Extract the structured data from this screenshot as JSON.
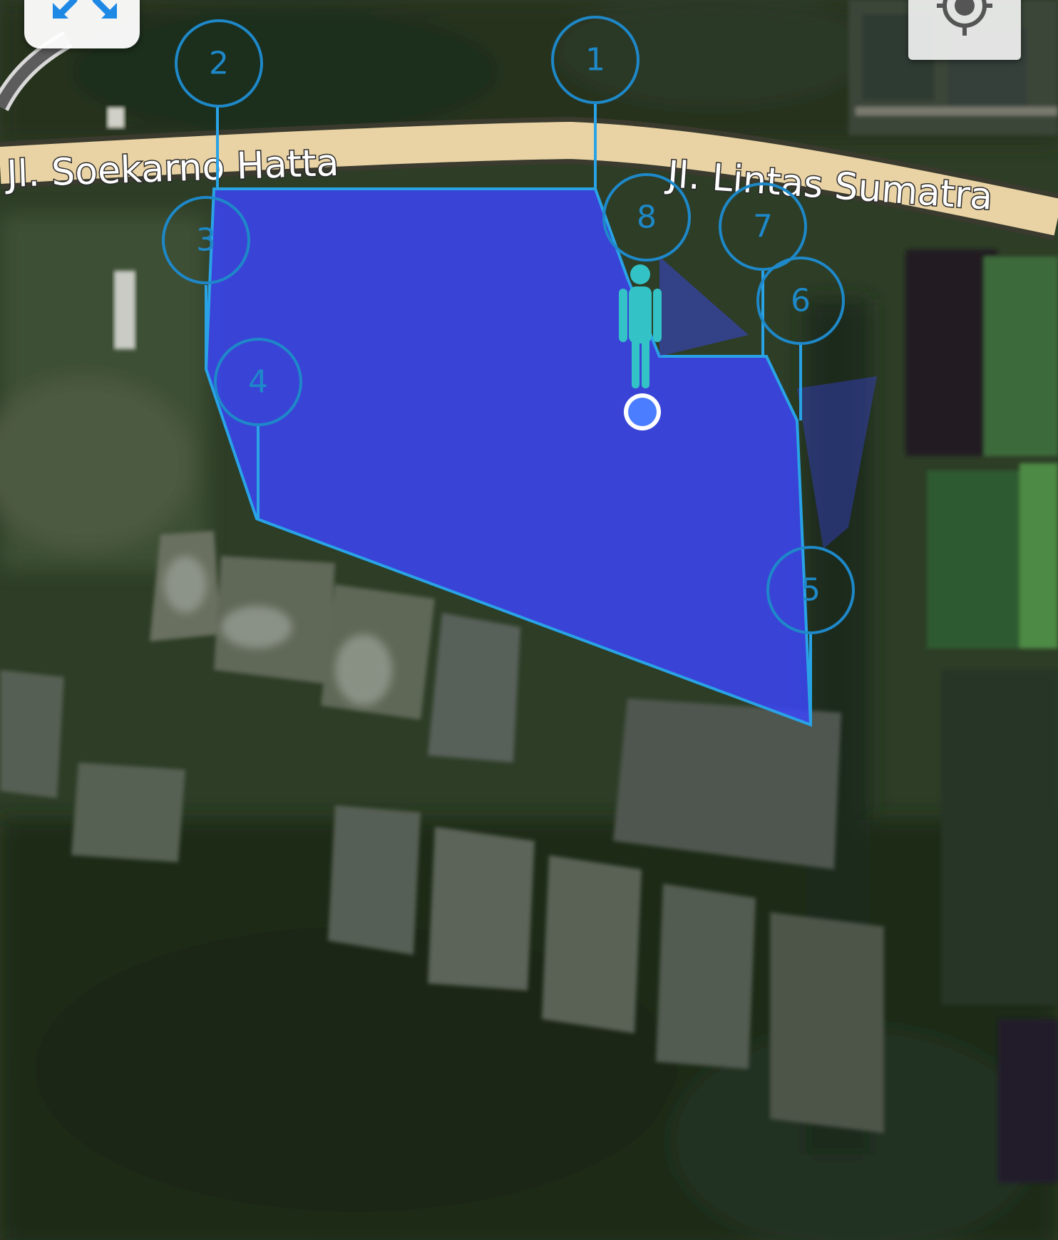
{
  "map": {
    "type": "satellite",
    "roads": [
      {
        "name": "Jl. Soekarno Hatta"
      },
      {
        "name": "Jl. Lintas Sumatra"
      }
    ],
    "boundary_markers": [
      "1",
      "2",
      "3",
      "4",
      "5",
      "6",
      "7",
      "8"
    ],
    "colors": {
      "polygon_fill": "#3c46ff",
      "polygon_stroke": "#29a3e6",
      "marker_stroke": "#1e88c8",
      "user_dot": "#4a7dff",
      "street_view_figure": "#33c2c6",
      "road": "#e9d3a4"
    },
    "icons": {
      "fullscreen": "fullscreen-icon",
      "locate": "my-location-icon",
      "user_location": "user-location-dot",
      "street_view": "street-view-person-icon"
    }
  }
}
